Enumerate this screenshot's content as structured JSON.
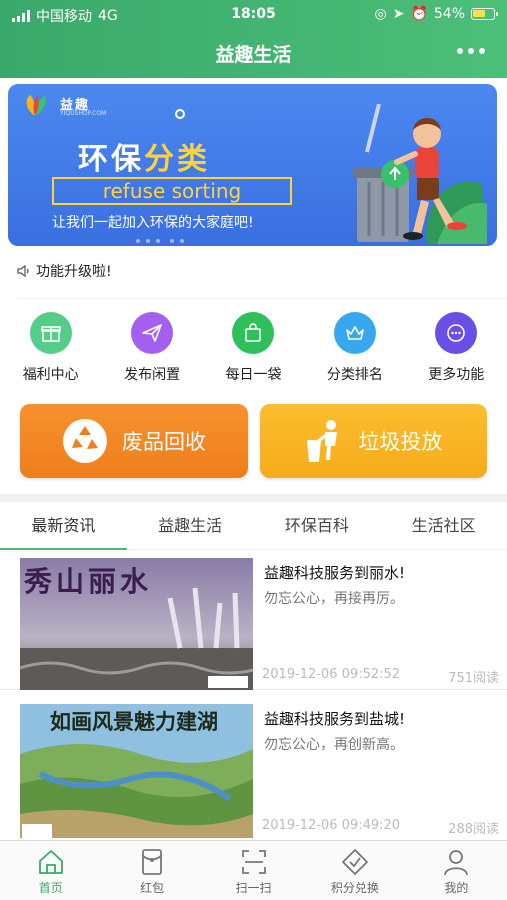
{
  "status_bar": {
    "carrier": "中国移动",
    "network": "4G",
    "time": "18:05",
    "battery": "54%"
  },
  "header": {
    "title": "益趣生活"
  },
  "banner": {
    "logo_text": "益趣",
    "logo_sub": "YIQUSHOP.COM",
    "headline_a": "环保",
    "headline_b": "分类",
    "subtitle": "refuse sorting",
    "slogan": "让我们一起加入环保的大家庭吧!"
  },
  "notice": {
    "text": "功能升级啦!"
  },
  "quick_actions": [
    {
      "label": "福利中心",
      "icon": "gift-icon",
      "color": "#55cc88"
    },
    {
      "label": "发布闲置",
      "icon": "paper-plane-icon",
      "color": "#a35ff0"
    },
    {
      "label": "每日一袋",
      "icon": "bag-icon",
      "color": "#2fbf5b"
    },
    {
      "label": "分类排名",
      "icon": "crown-icon",
      "color": "#38a8ee"
    },
    {
      "label": "更多功能",
      "icon": "more-icon",
      "color": "#6a4fe6"
    }
  ],
  "big_buttons": {
    "recycle": "废品回收",
    "dispose": "垃圾投放"
  },
  "tabs": [
    "最新资讯",
    "益趣生活",
    "环保百科",
    "生活社区"
  ],
  "news": [
    {
      "title": "益趣科技服务到丽水!",
      "desc": "勿忘公心，再接再厉。",
      "date": "2019-12-06 09:52:52",
      "reads": "751阅读",
      "thumb_text": "秀山丽水"
    },
    {
      "title": "益趣科技服务到盐城!",
      "desc": "勿忘公心，再创新高。",
      "date": "2019-12-06 09:49:20",
      "reads": "288阅读",
      "thumb_text": "如画风景魅力建湖"
    }
  ],
  "bottom_nav": [
    {
      "label": "首页",
      "icon": "home-icon"
    },
    {
      "label": "红包",
      "icon": "red-envelope-icon"
    },
    {
      "label": "扫一扫",
      "icon": "scan-icon"
    },
    {
      "label": "积分兑换",
      "icon": "exchange-icon"
    },
    {
      "label": "我的",
      "icon": "user-icon"
    }
  ]
}
